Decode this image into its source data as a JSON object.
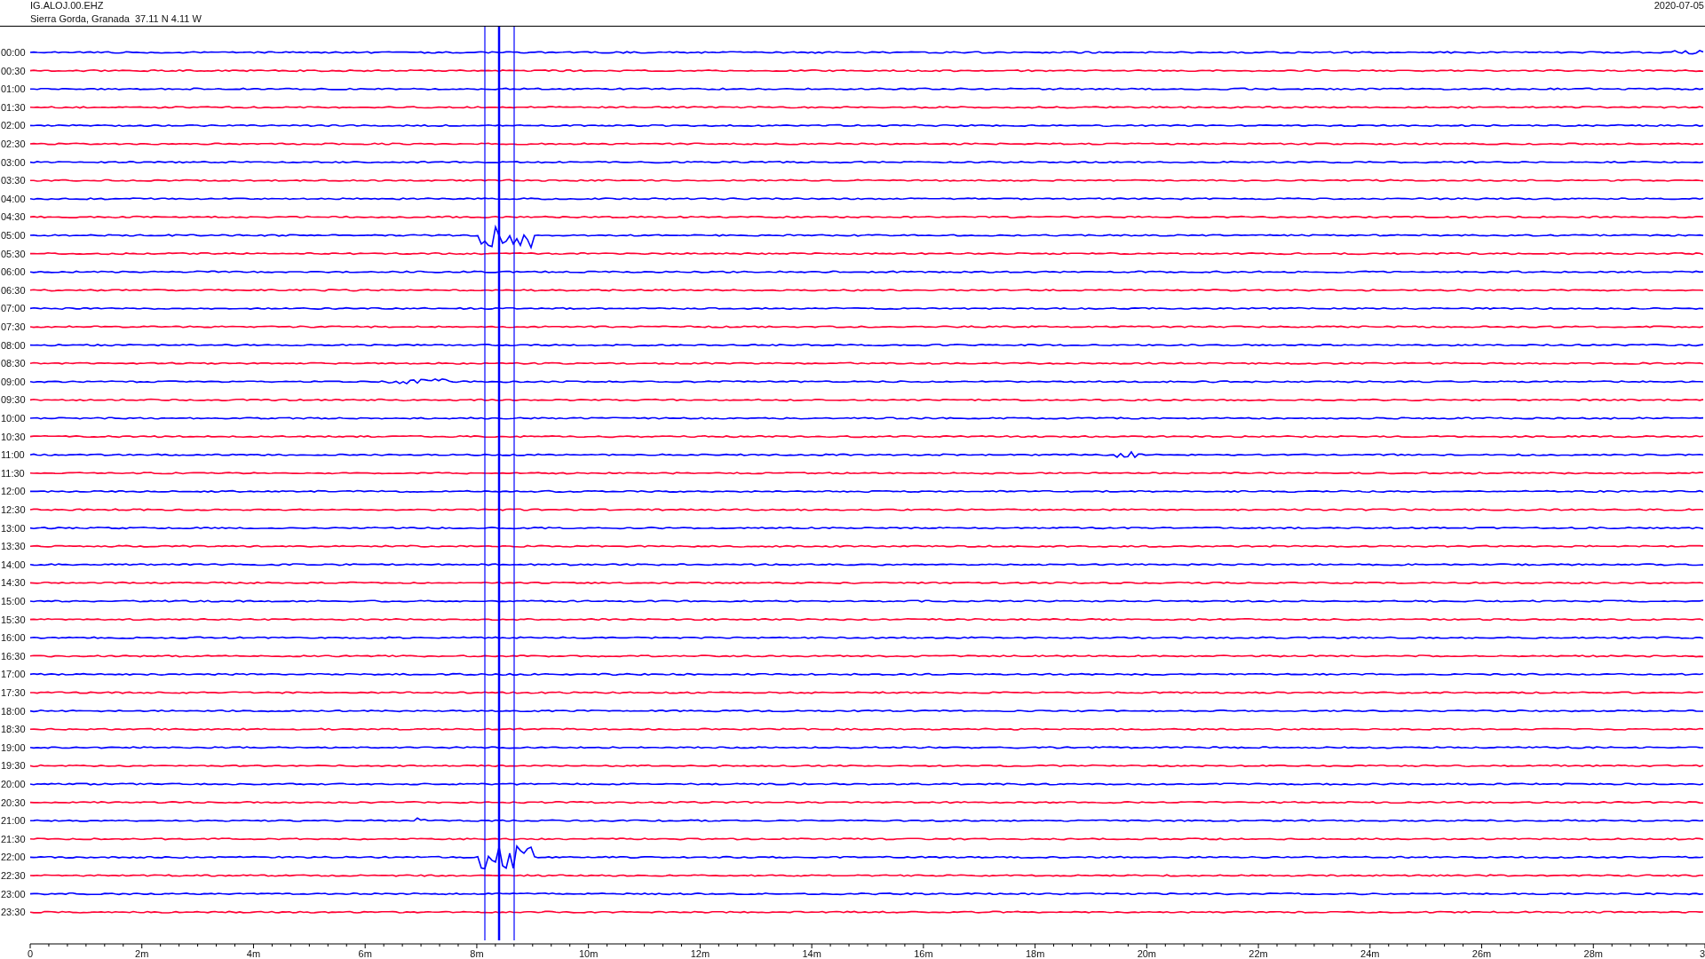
{
  "header": {
    "station": "IG.ALOJ.00.EHZ",
    "location": "Sierra Gorda, Granada  37.11 N 4.11 W",
    "date": "2020-07-05"
  },
  "rows": [
    {
      "label": "00:00",
      "color": "#0000ff"
    },
    {
      "label": "00:30",
      "color": "#ff0033"
    },
    {
      "label": "01:00",
      "color": "#0000ff"
    },
    {
      "label": "01:30",
      "color": "#ff0033"
    },
    {
      "label": "02:00",
      "color": "#0000ff"
    },
    {
      "label": "02:30",
      "color": "#ff0033"
    },
    {
      "label": "03:00",
      "color": "#0000ff"
    },
    {
      "label": "03:30",
      "color": "#ff0033"
    },
    {
      "label": "04:00",
      "color": "#0000ff"
    },
    {
      "label": "04:30",
      "color": "#ff0033"
    },
    {
      "label": "05:00",
      "color": "#0000ff"
    },
    {
      "label": "05:30",
      "color": "#ff0033"
    },
    {
      "label": "06:00",
      "color": "#0000ff"
    },
    {
      "label": "06:30",
      "color": "#ff0033"
    },
    {
      "label": "07:00",
      "color": "#0000ff"
    },
    {
      "label": "07:30",
      "color": "#ff0033"
    },
    {
      "label": "08:00",
      "color": "#0000ff"
    },
    {
      "label": "08:30",
      "color": "#ff0033"
    },
    {
      "label": "09:00",
      "color": "#0000ff"
    },
    {
      "label": "09:30",
      "color": "#ff0033"
    },
    {
      "label": "10:00",
      "color": "#0000ff"
    },
    {
      "label": "10:30",
      "color": "#ff0033"
    },
    {
      "label": "11:00",
      "color": "#0000ff"
    },
    {
      "label": "11:30",
      "color": "#ff0033"
    },
    {
      "label": "12:00",
      "color": "#0000ff"
    },
    {
      "label": "12:30",
      "color": "#ff0033"
    },
    {
      "label": "13:00",
      "color": "#0000ff"
    },
    {
      "label": "13:30",
      "color": "#ff0033"
    },
    {
      "label": "14:00",
      "color": "#0000ff"
    },
    {
      "label": "14:30",
      "color": "#ff0033"
    },
    {
      "label": "15:00",
      "color": "#0000ff"
    },
    {
      "label": "15:30",
      "color": "#ff0033"
    },
    {
      "label": "16:00",
      "color": "#0000ff"
    },
    {
      "label": "16:30",
      "color": "#ff0033"
    },
    {
      "label": "17:00",
      "color": "#0000ff"
    },
    {
      "label": "17:30",
      "color": "#ff0033"
    },
    {
      "label": "18:00",
      "color": "#0000ff"
    },
    {
      "label": "18:30",
      "color": "#ff0033"
    },
    {
      "label": "19:00",
      "color": "#0000ff"
    },
    {
      "label": "19:30",
      "color": "#ff0033"
    },
    {
      "label": "20:00",
      "color": "#0000ff"
    },
    {
      "label": "20:30",
      "color": "#ff0033"
    },
    {
      "label": "21:00",
      "color": "#0000ff"
    },
    {
      "label": "21:30",
      "color": "#ff0033"
    },
    {
      "label": "22:00",
      "color": "#0000ff"
    },
    {
      "label": "22:30",
      "color": "#ff0033"
    },
    {
      "label": "23:00",
      "color": "#0000ff"
    },
    {
      "label": "23:30",
      "color": "#ff0033"
    }
  ],
  "axis": {
    "labels": [
      "0",
      "2m",
      "4m",
      "6m",
      "8m",
      "10m",
      "12m",
      "14m",
      "16m",
      "18m",
      "20m",
      "22m",
      "24m",
      "26m",
      "28m",
      "3"
    ]
  }
}
